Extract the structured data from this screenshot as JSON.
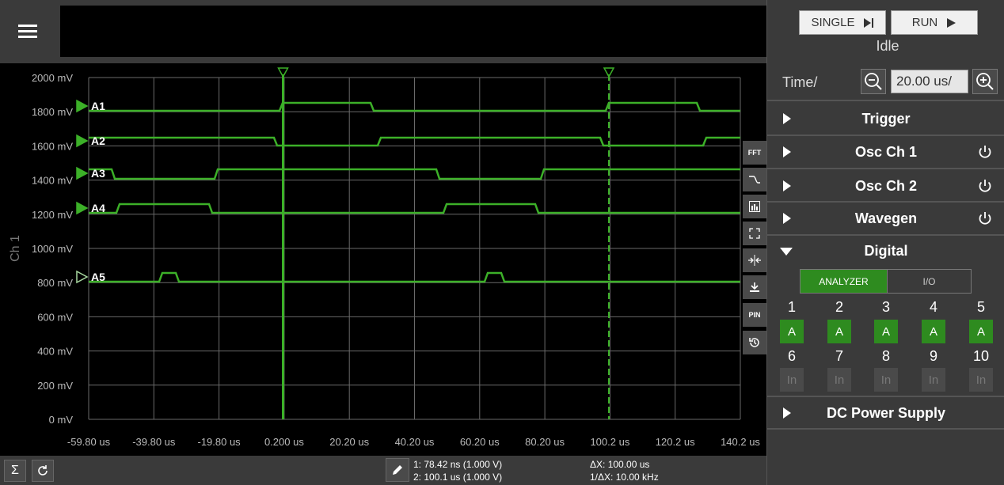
{
  "toolbar": {
    "menu_icon": "hamburger-icon"
  },
  "plot": {
    "y_axis_title": "Ch 1",
    "y_ticks": [
      "2000 mV",
      "1800 mV",
      "1600 mV",
      "1400 mV",
      "1200 mV",
      "1000 mV",
      "800 mV",
      "600 mV",
      "400 mV",
      "200 mV",
      "0 mV"
    ],
    "x_ticks": [
      "-59.80 us",
      "-39.80 us",
      "-19.80 us",
      "0.200 us",
      "20.20 us",
      "40.20 us",
      "60.20 us",
      "80.20 us",
      "100.2 us",
      "120.2 us",
      "140.2 us"
    ],
    "channels": [
      {
        "label": "A1",
        "marker_color": "#3cb028"
      },
      {
        "label": "A2",
        "marker_color": "#3cb028"
      },
      {
        "label": "A3",
        "marker_color": "#3cb028"
      },
      {
        "label": "A4",
        "marker_color": "#3cb028"
      },
      {
        "label": "A5",
        "marker_color": "#a8d8a0"
      }
    ],
    "trace_color": "#3cb028",
    "grid_color": "#6a6a6a"
  },
  "side_tools": [
    {
      "label": "FFT",
      "icon": "fft-icon"
    },
    {
      "label": "",
      "icon": "edge-icon"
    },
    {
      "label": "",
      "icon": "bar-chart-icon"
    },
    {
      "label": "",
      "icon": "fullscreen-icon"
    },
    {
      "label": "",
      "icon": "split-icon"
    },
    {
      "label": "",
      "icon": "download-icon"
    },
    {
      "label": "PIN",
      "icon": "pin-icon"
    },
    {
      "label": "",
      "icon": "history-icon"
    }
  ],
  "bottom": {
    "sum_label": "Σ",
    "cursor1": "1: 78.42 ns (1.000 V)",
    "cursor2": "2: 100.1 us (1.000 V)",
    "delta_x": "ΔX: 100.00 us",
    "inv_delta_x": "1/ΔX: 10.00 kHz"
  },
  "controls": {
    "single_label": "SINGLE",
    "run_label": "RUN",
    "status": "Idle",
    "time_label": "Time/",
    "time_value": "20.00 us/"
  },
  "sections": {
    "trigger": "Trigger",
    "osc1": "Osc Ch 1",
    "osc2": "Osc Ch 2",
    "wavegen": "Wavegen",
    "digital": "Digital",
    "dc_power": "DC Power Supply"
  },
  "digital": {
    "tab_analyzer": "ANALYZER",
    "tab_io": "I/O",
    "pins_row1": [
      {
        "num": "1",
        "mode": "A"
      },
      {
        "num": "2",
        "mode": "A"
      },
      {
        "num": "3",
        "mode": "A"
      },
      {
        "num": "4",
        "mode": "A"
      },
      {
        "num": "5",
        "mode": "A"
      }
    ],
    "pins_row2": [
      {
        "num": "6",
        "mode": "In"
      },
      {
        "num": "7",
        "mode": "In"
      },
      {
        "num": "8",
        "mode": "In"
      },
      {
        "num": "9",
        "mode": "In"
      },
      {
        "num": "10",
        "mode": "In"
      }
    ]
  }
}
